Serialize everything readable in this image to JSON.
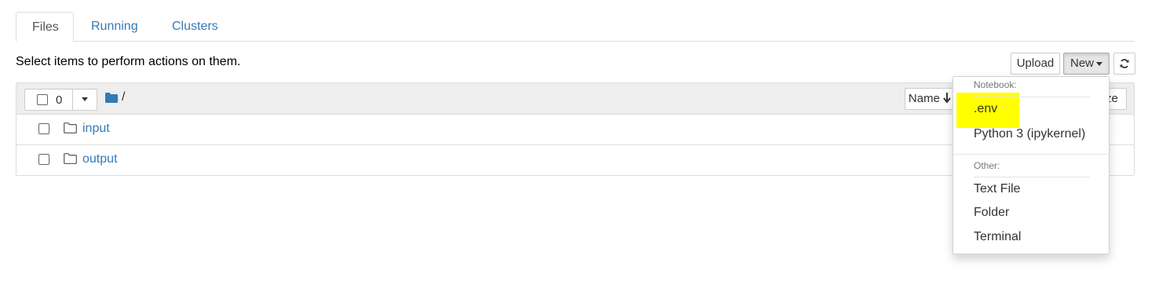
{
  "tabs": [
    {
      "label": "Files",
      "active": true
    },
    {
      "label": "Running",
      "active": false
    },
    {
      "label": "Clusters",
      "active": false
    }
  ],
  "instructions": "Select items to perform actions on them.",
  "toolbar": {
    "upload_label": "Upload",
    "new_label": "New",
    "refresh_icon": "refresh-icon"
  },
  "file_list": {
    "selected_count": "0",
    "path": "/",
    "sort_label": "Name",
    "sort_icon": "arrow-down-icon",
    "size_label_partial": "ze",
    "items": [
      {
        "name": "input",
        "type": "folder"
      },
      {
        "name": "output",
        "type": "folder"
      }
    ]
  },
  "new_menu": {
    "notebook_header": "Notebook:",
    "notebook_items": [
      ".env",
      "Python 3 (ipykernel)"
    ],
    "other_header": "Other:",
    "other_items": [
      "Text File",
      "Folder",
      "Terminal"
    ],
    "highlight_color": "#ffff00"
  },
  "colors": {
    "link": "#337ab7",
    "header_bg": "#eeeeee",
    "border": "#dddddd"
  }
}
